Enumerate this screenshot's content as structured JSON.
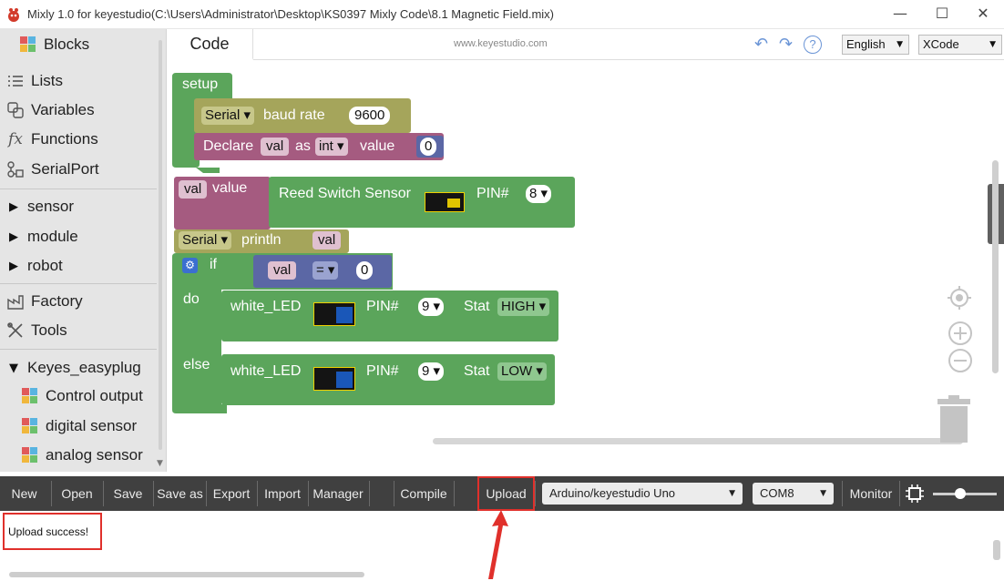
{
  "window": {
    "title": "Mixly 1.0 for keyestudio(C:\\Users\\Administrator\\Desktop\\KS0397 Mixly Code\\8.1 Magnetic Field.mix)",
    "minimize": "—",
    "maximize": "☐",
    "close": "✕"
  },
  "sidebar": {
    "blocks_label": "Blocks",
    "items": [
      {
        "label": "Lists",
        "icon": "list-icon"
      },
      {
        "label": "Variables",
        "icon": "variables-icon"
      },
      {
        "label": "Functions",
        "icon": "function-icon"
      },
      {
        "label": "SerialPort",
        "icon": "serialport-icon"
      },
      {
        "label": "sensor",
        "icon": "triangle-right-icon"
      },
      {
        "label": "module",
        "icon": "triangle-right-icon"
      },
      {
        "label": "robot",
        "icon": "triangle-right-icon"
      },
      {
        "label": "Factory",
        "icon": "factory-icon"
      },
      {
        "label": "Tools",
        "icon": "tools-icon"
      },
      {
        "label": "Keyes_easyplug",
        "icon": "triangle-down-icon"
      },
      {
        "label": "Control output",
        "icon": "puzzle-icon"
      },
      {
        "label": "digital sensor",
        "icon": "puzzle-icon"
      },
      {
        "label": "analog sensor",
        "icon": "puzzle-icon"
      }
    ]
  },
  "codebar": {
    "tab": "Code",
    "site": "www.keyestudio.com",
    "language": "English",
    "theme": "XCode"
  },
  "blocks": {
    "setup": "setup",
    "serial": "Serial",
    "baud_rate": "baud rate",
    "baud_value": "9600",
    "declare": "Declare",
    "var_name": "val",
    "as": "as",
    "type": "int",
    "value": "value",
    "init_value": "0",
    "assign_var": "val",
    "assign_value": "value",
    "sensor_label": "Reed Switch Sensor",
    "pin_label": "PIN#",
    "sensor_pin": "8",
    "println": "println",
    "println_var": "val",
    "if": "if",
    "cond_var": "val",
    "cond_op": "=",
    "cond_value": "0",
    "do": "do",
    "else": "else",
    "led_label": "white_LED",
    "led_pin": "9",
    "stat_label": "Stat",
    "stat_high": "HIGH",
    "stat_low": "LOW"
  },
  "toolbar": {
    "new": "New",
    "open": "Open",
    "save": "Save",
    "save_as": "Save as",
    "export": "Export",
    "import": "Import",
    "manager": "Manager",
    "compile": "Compile",
    "upload": "Upload",
    "board": "Arduino/keyestudio Uno",
    "port": "COM8",
    "monitor": "Monitor"
  },
  "output": {
    "message": "Upload success!"
  },
  "colors": {
    "green_block": "#5ba55b",
    "olive_block": "#a5a55b",
    "magenta_block": "#a55b80",
    "blue_block": "#5b67a5",
    "highlight_red": "#e0302b",
    "toolbar_bg": "#404040"
  }
}
